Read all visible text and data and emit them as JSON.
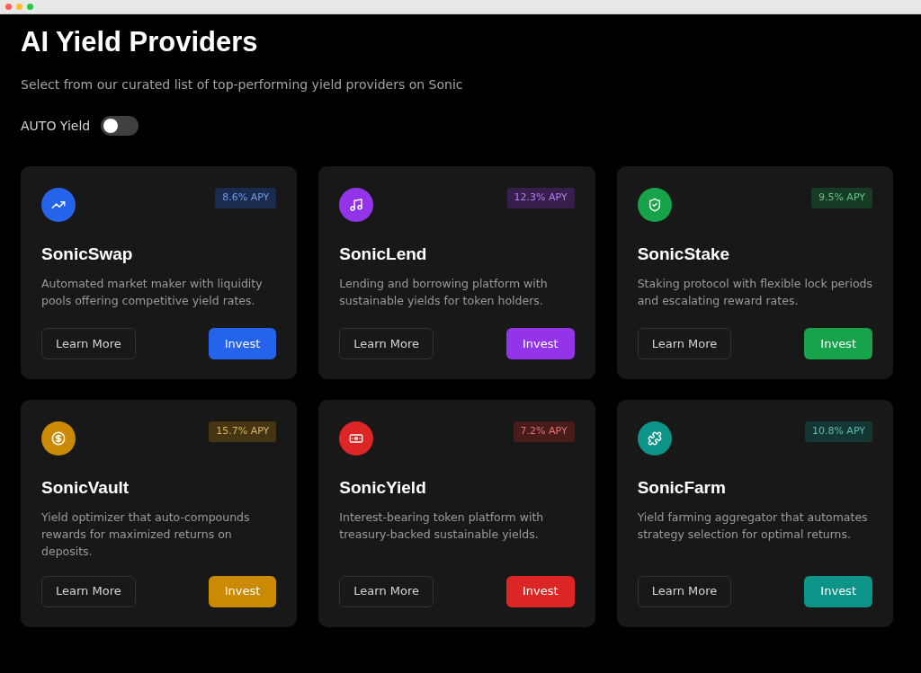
{
  "title": "AI Yield Providers",
  "subtitle": "Select from our curated list of top-performing yield providers on Sonic",
  "auto_yield": {
    "label": "AUTO Yield",
    "on": false
  },
  "providers": [
    {
      "name": "SonicSwap",
      "color": "#2563eb",
      "apy": "8.6% APY",
      "description": "Automated market maker with liquidity pools offering competitive yield rates.",
      "secondary": "Learn More",
      "primary": "Invest"
    },
    {
      "name": "SonicLend",
      "color": "#9333ea",
      "apy": "12.3% APY",
      "description": "Lending and borrowing platform with sustainable yields for token holders.",
      "secondary": "Learn More",
      "primary": "Invest"
    },
    {
      "name": "SonicStake",
      "color": "#16a34a",
      "apy": "9.5% APY",
      "description": "Staking protocol with flexible lock periods and escalating reward rates.",
      "secondary": "Learn More",
      "primary": "Invest"
    },
    {
      "name": "SonicVault",
      "color": "#ca8a04",
      "apy": "15.7% APY",
      "description": "Yield optimizer that auto-compounds rewards for maximized returns on deposits.",
      "secondary": "Learn More",
      "primary": "Invest"
    },
    {
      "name": "SonicYield",
      "color": "#dc2626",
      "apy": "7.2% APY",
      "description": "Interest-bearing token platform with treasury-backed sustainable yields.",
      "secondary": "Learn More",
      "primary": "Invest"
    },
    {
      "name": "SonicFarm",
      "color": "#0d9488",
      "apy": "10.8% APY",
      "description": "Yield farming aggregator that automates strategy selection for optimal returns.",
      "secondary": "Learn More",
      "primary": "Invest"
    }
  ]
}
